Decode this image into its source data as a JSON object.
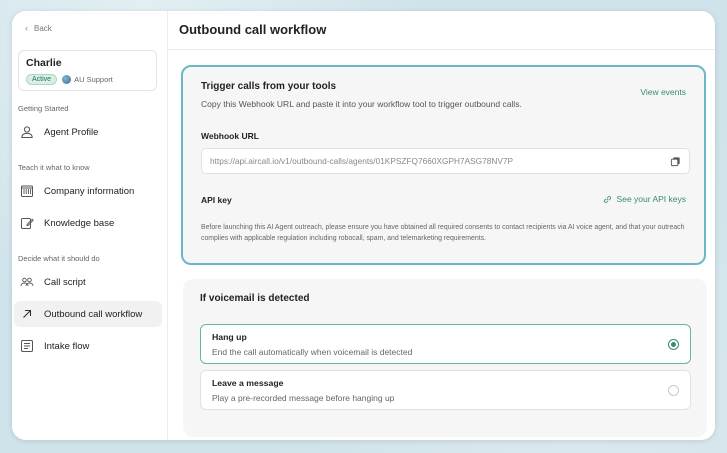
{
  "sidebar": {
    "back_label": "Back",
    "agent": {
      "name": "Charlie",
      "status": "Active",
      "team": "AU Support"
    },
    "sections": [
      {
        "label": "Getting Started",
        "items": [
          {
            "label": "Agent Profile",
            "icon": "user-icon"
          }
        ]
      },
      {
        "label": "Teach it what to know",
        "items": [
          {
            "label": "Company information",
            "icon": "building-icon"
          },
          {
            "label": "Knowledge base",
            "icon": "edit-document-icon"
          }
        ]
      },
      {
        "label": "Decide what it should do",
        "items": [
          {
            "label": "Call script",
            "icon": "people-icon"
          },
          {
            "label": "Outbound call workflow",
            "icon": "arrow-up-right-icon",
            "active": true
          },
          {
            "label": "Intake flow",
            "icon": "form-icon"
          }
        ]
      }
    ]
  },
  "main": {
    "title": "Outbound call workflow",
    "trigger": {
      "title": "Trigger calls from your tools",
      "description": "Copy this Webhook URL and paste it into your workflow tool to trigger outbound calls.",
      "view_events": "View events",
      "webhook_label": "Webhook URL",
      "webhook_url": "https://api.aircall.io/v1/outbound-calls/agents/01KPSZFQ7660XGPH7ASG78NV7P",
      "api_key_label": "API key",
      "api_key_link": "See your API keys",
      "disclaimer": "Before launching this AI Agent outreach, please ensure you have obtained all required consents to contact recipients via AI voice agent, and that your outreach complies with applicable regulation including robocall, spam, and telemarketing requirements."
    },
    "voicemail": {
      "title": "If voicemail is detected",
      "options": [
        {
          "title": "Hang up",
          "description": "End the call automatically when voicemail is detected",
          "selected": true
        },
        {
          "title": "Leave a message",
          "description": "Play a pre-recorded message before hanging up",
          "selected": false
        }
      ]
    }
  },
  "colors": {
    "accent": "#3a8a74",
    "highlight_border": "#6bb7c6",
    "active_badge_bg": "#d7efe6"
  }
}
